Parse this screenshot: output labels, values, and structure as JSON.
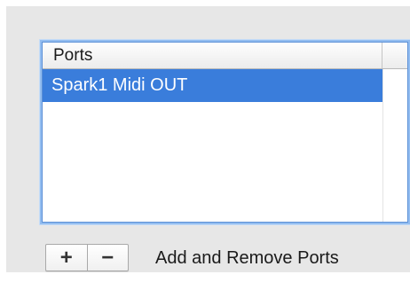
{
  "ports_table": {
    "column_header": "Ports",
    "rows": [
      {
        "label": "Spark1 Midi OUT",
        "selected": true
      }
    ]
  },
  "controls": {
    "add_label": "+",
    "remove_label": "−",
    "caption": "Add and Remove Ports"
  },
  "colors": {
    "selection": "#3a7ddb",
    "focus_ring": "#5b8fd6",
    "panel_background": "#e7e7e7"
  }
}
